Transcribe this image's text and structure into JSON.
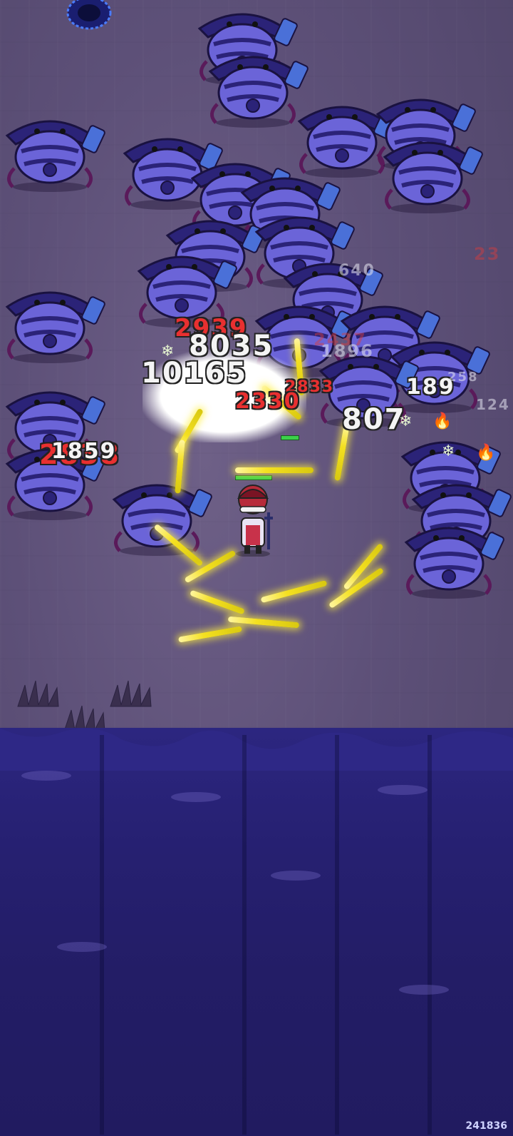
{
  "colors": {
    "ground": "#5d5078",
    "cliff": "#262071",
    "crab_body": "#6b64d8",
    "crab_shell": "#2b2378",
    "sword_glow": "#f4e020",
    "damage_white": "#f4f4f4",
    "damage_red": "#e83030"
  },
  "hud": {
    "score": "241836"
  },
  "damage_numbers": [
    {
      "text": "2939",
      "style": "red"
    },
    {
      "text": "8035",
      "style": "white"
    },
    {
      "text": "10165",
      "style": "white"
    },
    {
      "text": "1896",
      "style": "faint"
    },
    {
      "text": "2833",
      "style": "red"
    },
    {
      "text": "2330",
      "style": "red"
    },
    {
      "text": "807",
      "style": "white"
    },
    {
      "text": "189",
      "style": "white"
    },
    {
      "text": "2838",
      "style": "red"
    },
    {
      "text": "1859",
      "style": "white"
    },
    {
      "text": "640",
      "style": "faint"
    },
    {
      "text": "23",
      "style": "faintred"
    },
    {
      "text": "258",
      "style": "faint"
    },
    {
      "text": "124",
      "style": "faint"
    },
    {
      "text": "2437",
      "style": "faintred"
    }
  ],
  "status_icons": [
    "frost-icon",
    "fire-icon"
  ]
}
